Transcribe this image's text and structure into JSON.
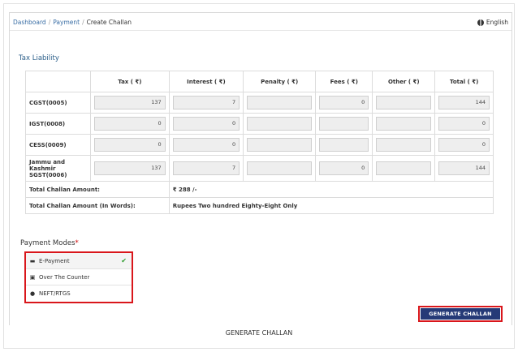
{
  "breadcrumb": {
    "items": [
      "Dashboard",
      "Payment"
    ],
    "current": "Create Challan",
    "separator": "/"
  },
  "language": {
    "icon": "globe-icon",
    "label": "English"
  },
  "tax_liability": {
    "title": "Tax Liability",
    "headers": [
      "",
      "Tax ( ₹)",
      "Interest ( ₹)",
      "Penalty ( ₹)",
      "Fees ( ₹)",
      "Other ( ₹)",
      "Total ( ₹)"
    ],
    "rows": [
      {
        "label": "CGST(0005)",
        "tax": "137",
        "interest": "7",
        "penalty": "",
        "fees": "0",
        "other": "",
        "total": "144"
      },
      {
        "label": "IGST(0008)",
        "tax": "0",
        "interest": "0",
        "penalty": "",
        "fees": "",
        "other": "",
        "total": "0"
      },
      {
        "label": "CESS(0009)",
        "tax": "0",
        "interest": "0",
        "penalty": "",
        "fees": "",
        "other": "",
        "total": "0"
      },
      {
        "label": "Jammu and Kashmir SGST(0006)",
        "tax": "137",
        "interest": "7",
        "penalty": "",
        "fees": "0",
        "other": "",
        "total": "144"
      }
    ],
    "total_label": "Total Challan Amount:",
    "total_value": "₹ 288 /-",
    "words_label": "Total Challan Amount (In Words):",
    "words_value": "Rupees Two hundred Eighty-Eight Only"
  },
  "payment_modes": {
    "label": "Payment Modes",
    "required_mark": "*",
    "options": [
      {
        "label": "E-Payment",
        "icon": "credit-card-icon",
        "selected": true
      },
      {
        "label": "Over The Counter",
        "icon": "cash-icon",
        "selected": false
      },
      {
        "label": "NEFT/RTGS",
        "icon": "globe-icon",
        "selected": false
      }
    ]
  },
  "generate_button": {
    "label": "GENERATE CHALLAN"
  },
  "caption": "GENERATE CHALLAN",
  "colors": {
    "accent_red": "#d9161b",
    "button_bg": "#253a77",
    "link": "#3a6ea5",
    "check": "#2e9b2e"
  }
}
